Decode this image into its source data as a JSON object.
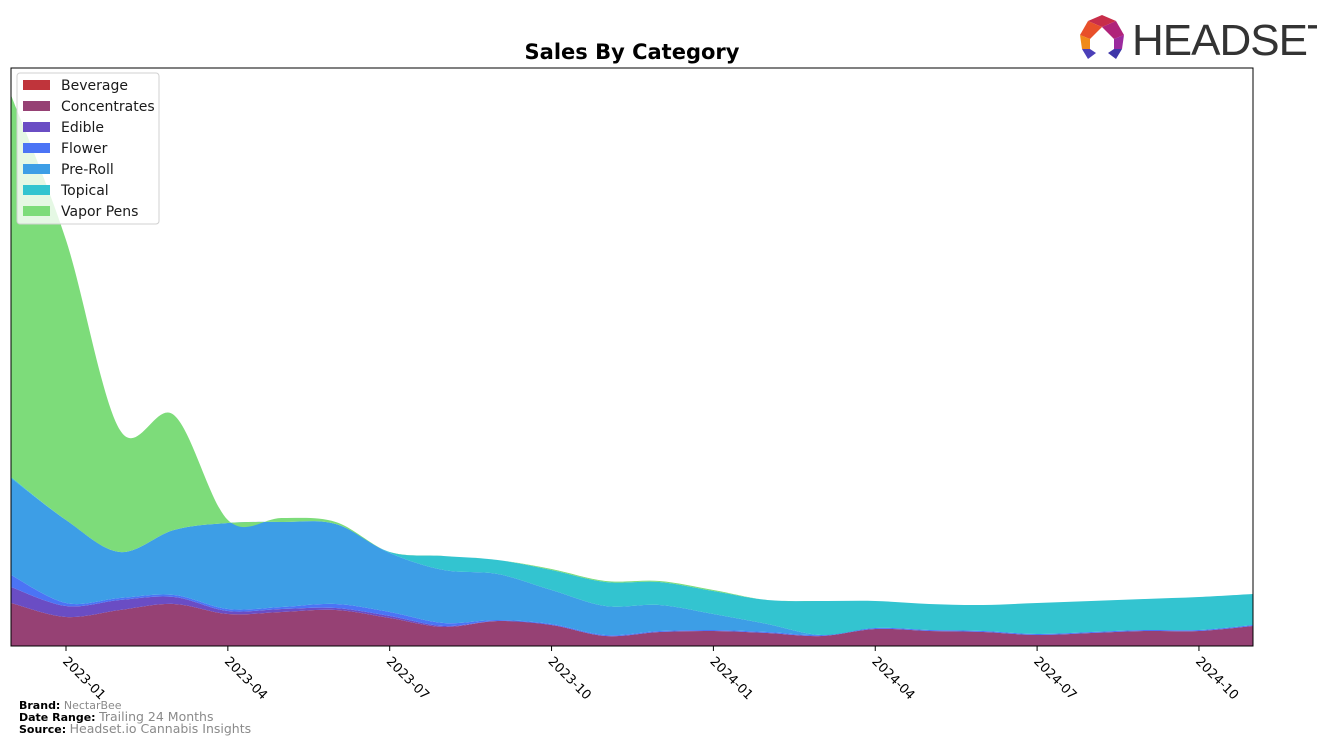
{
  "logo": {
    "text": "HEADSET"
  },
  "footer": {
    "brand_label": "Brand:",
    "brand_value": "NectarBee",
    "date_label": "Date Range:",
    "date_value": "Trailing 24 Months",
    "source_label": "Source:",
    "source_value": "Headset.io Cannabis Insights"
  },
  "chart_data": {
    "type": "area",
    "stacked": true,
    "title": "Sales By Category",
    "xlabel": "",
    "ylabel": "",
    "y_axis_visible": false,
    "grid": false,
    "legend_position": "top-left",
    "x": [
      "2022-12",
      "2023-01",
      "2023-02",
      "2023-03",
      "2023-04",
      "2023-05",
      "2023-06",
      "2023-07",
      "2023-08",
      "2023-09",
      "2023-10",
      "2023-11",
      "2023-12",
      "2024-01",
      "2024-02",
      "2024-03",
      "2024-04",
      "2024-05",
      "2024-06",
      "2024-07",
      "2024-08",
      "2024-09",
      "2024-10",
      "2024-11"
    ],
    "x_ticks": [
      "2023-01",
      "2023-04",
      "2023-07",
      "2023-10",
      "2024-01",
      "2024-04",
      "2024-07",
      "2024-10"
    ],
    "ylim": [
      0,
      578
    ],
    "series": [
      {
        "name": "Beverage",
        "color": "#c0343b",
        "values": [
          0,
          0,
          0,
          0,
          0,
          0,
          0,
          0,
          0,
          0,
          0,
          0,
          0,
          0,
          0,
          0,
          0,
          0,
          0,
          0,
          0,
          0,
          0,
          0
        ]
      },
      {
        "name": "Concentrates",
        "color": "#964174",
        "values": [
          43,
          29,
          36,
          42,
          32,
          34,
          36,
          28,
          19,
          25,
          21,
          10,
          14,
          15,
          13,
          10,
          17,
          15,
          14,
          11,
          13,
          15,
          15,
          20
        ]
      },
      {
        "name": "Edible",
        "color": "#6a4dc4",
        "values": [
          16,
          11,
          10,
          7,
          3,
          3,
          2,
          2,
          1,
          0,
          0,
          0,
          0,
          0,
          0,
          0,
          0,
          0,
          0,
          0,
          0,
          0,
          0,
          0
        ]
      },
      {
        "name": "Flower",
        "color": "#4b74f5",
        "values": [
          12,
          3,
          2,
          2,
          2,
          2,
          4,
          4,
          3,
          1,
          1,
          1,
          1,
          1,
          1,
          1,
          1,
          1,
          1,
          1,
          1,
          1,
          1,
          1
        ]
      },
      {
        "name": "Pre-Roll",
        "color": "#3d9ee6",
        "values": [
          97,
          83,
          46,
          65,
          86,
          85,
          80,
          59,
          53,
          46,
          34,
          29,
          26,
          16,
          8,
          0,
          0,
          0,
          0,
          0,
          0,
          0,
          0,
          0
        ]
      },
      {
        "name": "Topical",
        "color": "#33c4d0",
        "values": [
          1,
          0,
          0,
          0,
          0,
          0,
          0,
          1,
          14,
          14,
          20,
          24,
          23,
          23,
          24,
          34,
          27,
          26,
          26,
          31,
          31,
          31,
          33,
          31
        ]
      },
      {
        "name": "Vapor Pens",
        "color": "#7ddc7a",
        "values": [
          382,
          280,
          122,
          115,
          3,
          4,
          2,
          0,
          0,
          0,
          1,
          1,
          1,
          1,
          0,
          0,
          0,
          0,
          0,
          0,
          0,
          0,
          0,
          0
        ]
      }
    ]
  }
}
